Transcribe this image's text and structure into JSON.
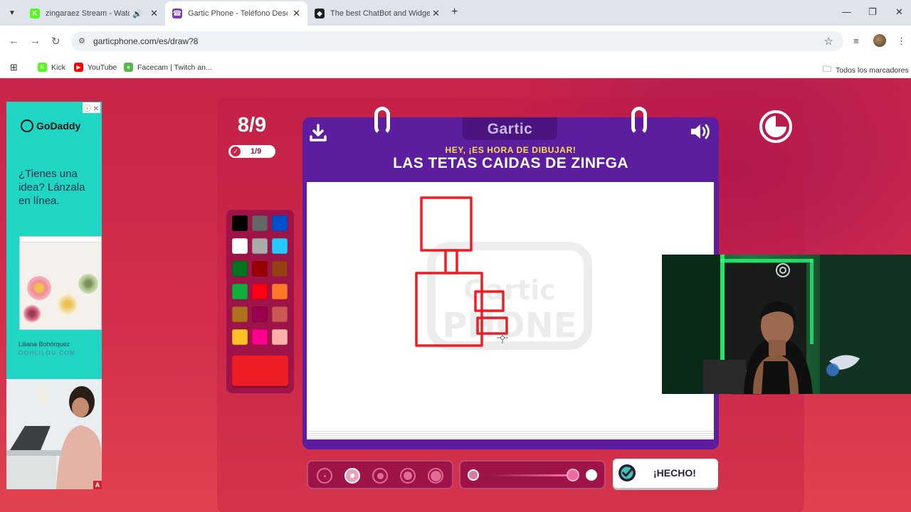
{
  "browser": {
    "tabs": [
      {
        "title": "zingaraez Stream - Watch L",
        "favicon_color": "#53fc18",
        "favicon_glyph": "K",
        "audio_icon": "speaker-icon"
      },
      {
        "title": "Gartic Phone - Teléfono Descon",
        "favicon_color": "#7b3fb0",
        "favicon_glyph": "☎",
        "active": true
      },
      {
        "title": "The best ChatBot and Widgets f",
        "favicon_color": "#1c1f26",
        "favicon_glyph": "◆"
      }
    ],
    "url": "garticphone.com/es/draw?8",
    "bookmarks": [
      {
        "label": "Kick",
        "icon_color": "#53fc18"
      },
      {
        "label": "YouTube",
        "icon_color": "#ff0000"
      },
      {
        "label": "Facecam | Twitch an...",
        "icon_color": "#56b94a"
      }
    ],
    "all_bookmarks": "Todos los marcadores"
  },
  "ad": {
    "brand": "GoDaddy",
    "headline": "¿Tienes una idea? Lánzala en línea.",
    "signature": "Liliana Bohórquez",
    "site": "OOHLILOU.COM",
    "flag": "A"
  },
  "game": {
    "round": "8/9",
    "players_done": "1/9",
    "logo": "Gartic",
    "subtitle": "HEY, ¡ES HORA DE DIBUJAR!",
    "prompt": "LAS TETAS CAIDAS DE ZINFGA",
    "watermark_top": "Gartic",
    "watermark_bottom": "PHONE",
    "done_button": "¡HECHO!",
    "timer_fraction_elapsed": 0.25,
    "colors": {
      "board_purple": "#5c1d9e",
      "accent_red": "#ee1c24",
      "palette_bg": "#9e1348"
    },
    "palette": [
      "#000000",
      "#666666",
      "#0050cd",
      "#ffffff",
      "#aaaaaa",
      "#26c9ff",
      "#017420",
      "#990000",
      "#964112",
      "#11b03c",
      "#ff0013",
      "#ff7829",
      "#b0701c",
      "#99004e",
      "#cb5a57",
      "#ffc126",
      "#ff008f",
      "#feafa8"
    ],
    "selected_color": "#ee1c24",
    "brush_sizes": 5,
    "selected_brush_size": 2,
    "tools": [
      "line-tool-icon",
      "fill-bucket-icon",
      "undo-icon",
      "redo-icon"
    ]
  }
}
